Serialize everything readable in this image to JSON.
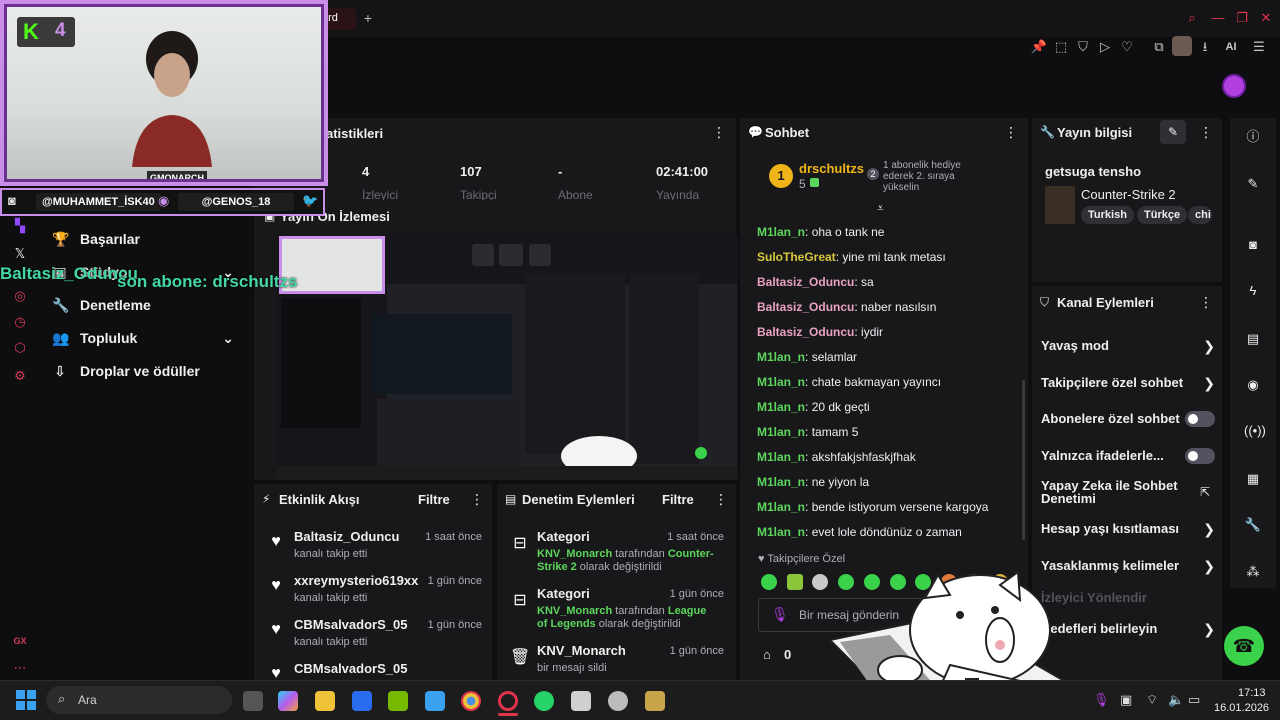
{
  "browser": {
    "active_tab_suffix": "ard",
    "add_tab": "+",
    "ai_label": "AI"
  },
  "webcam": {
    "logo_letter": "K",
    "logo_number": "4",
    "streamer_tag": "GMONARCH"
  },
  "socials": {
    "instagram": "@MUHAMMET_İSK40",
    "twitch": "@GENOS_18"
  },
  "sub_alert": "son abone: drschultzs",
  "sub_alert_name_overlay": "Baltasiz_Oduncu",
  "sidebar": {
    "items": [
      {
        "label": "Başarılar"
      },
      {
        "label": "Stüdyo"
      },
      {
        "label": "Denetleme"
      },
      {
        "label": "Topluluk"
      },
      {
        "label": "Droplar ve ödüller"
      }
    ],
    "footer": "GX"
  },
  "stats": {
    "title_partial": "atistikleri",
    "values": [
      {
        "value": "4",
        "label": "İzleyici"
      },
      {
        "value": "107",
        "label": "Takipçi"
      },
      {
        "value": "-",
        "label": "Abone"
      },
      {
        "value": "02:41:00",
        "label": "Yayında"
      }
    ]
  },
  "preview": {
    "title": "Yayın Ön İzlemesi"
  },
  "activity": {
    "title": "Etkinlik Akışı",
    "filter": "Filtre",
    "items": [
      {
        "name": "Baltasiz_Oduncu",
        "action": "kanalı takip etti",
        "time": "1 saat önce"
      },
      {
        "name": "xxreymysterio619xx",
        "action": "kanalı takip etti",
        "time": "1 gün önce"
      },
      {
        "name": "CBMsalvadorS_05",
        "action": "kanalı takip etti",
        "time": "1 gün önce"
      },
      {
        "name": "CBMsalvadorS_05",
        "action": "",
        "time": ""
      }
    ]
  },
  "moderation": {
    "title": "Denetim Eylemleri",
    "filter": "Filtre",
    "items": [
      {
        "name": "Kategori",
        "time": "1 saat önce",
        "user": "KNV_Monarch",
        "mid": " tarafından ",
        "target": "Counter-Strike 2",
        "end": " olarak değiştirildi"
      },
      {
        "name": "Kategori",
        "time": "1 gün önce",
        "user": "KNV_Monarch",
        "mid": " tarafından ",
        "target": "League of Legends",
        "end": " olarak değiştirildi"
      },
      {
        "name": "KNV_Monarch",
        "time": "1 gün önce",
        "user": "",
        "mid": "bir mesajı sildi",
        "target": "",
        "end": ""
      }
    ]
  },
  "chat": {
    "title": "Sohbet",
    "top_user": "drschultzs",
    "top_rank": "1",
    "top_count": "5",
    "gift_rank": "2",
    "gift_text": "1 abonelik hediye ederek 2. sıraya yükselin",
    "messages": [
      {
        "user": "M1lan_n",
        "color": "#5cd65c",
        "text": "oha o tank ne"
      },
      {
        "user": "SuloTheGreat",
        "color": "#d7c83a",
        "text": "yine mi tank metası"
      },
      {
        "user": "Baltasiz_Oduncu",
        "color": "#e8a2c0",
        "text": "sa"
      },
      {
        "user": "Baltasiz_Oduncu",
        "color": "#e8a2c0",
        "text": "naber nasılsın"
      },
      {
        "user": "Baltasiz_Oduncu",
        "color": "#e8a2c0",
        "text": "iydir"
      },
      {
        "user": "M1lan_n",
        "color": "#5cd65c",
        "text": "selamlar"
      },
      {
        "user": "M1lan_n",
        "color": "#5cd65c",
        "text": "chate bakmayan yayıncı"
      },
      {
        "user": "M1lan_n",
        "color": "#5cd65c",
        "text": "20 dk geçti"
      },
      {
        "user": "M1lan_n",
        "color": "#5cd65c",
        "text": "tamam 5"
      },
      {
        "user": "M1lan_n",
        "color": "#5cd65c",
        "text": "akshfakjshfaskjfhak"
      },
      {
        "user": "M1lan_n",
        "color": "#5cd65c",
        "text": "ne yiyon la"
      },
      {
        "user": "M1lan_n",
        "color": "#5cd65c",
        "text": "bende istiyorum versene kargoya"
      },
      {
        "user": "M1lan_n",
        "color": "#5cd65c",
        "text": "evet lole döndünüz o zaman"
      }
    ],
    "followers_only": "Takipçilere Özel",
    "input_placeholder": "Bir mesaj gönderin",
    "points": "0"
  },
  "stream_info": {
    "title": "Yayın bilgisi",
    "stream_title": "getsuga tensho",
    "category": "Counter-Strike 2",
    "tags": [
      "Turkish",
      "Türkçe",
      "chi"
    ]
  },
  "channel_actions": {
    "title": "Kanal Eylemleri",
    "items": [
      {
        "label": "Yavaş mod",
        "kind": "chevron"
      },
      {
        "label": "Takipçilere özel sohbet",
        "kind": "chevron"
      },
      {
        "label": "Abonelere özel sohbet",
        "kind": "toggle"
      },
      {
        "label": "Yalnızca ifadelerle...",
        "kind": "toggle"
      },
      {
        "label": "Yapay Zeka ile Sohbet Denetimi",
        "kind": "external"
      },
      {
        "label": "Hesap yaşı kısıtlaması",
        "kind": "chevron"
      },
      {
        "label": "Yasaklanmış kelimeler",
        "kind": "chevron"
      },
      {
        "label": "İzleyici Yönlendir",
        "kind": "disabled"
      },
      {
        "label": "Hedefleri belirleyin",
        "kind": "chevron"
      }
    ]
  },
  "taskbar": {
    "search_label": "Ara",
    "time": "17:13",
    "date": "16.01.2026"
  },
  "colors": {
    "accent_green": "#5cd65c",
    "brand_red": "#d43b59",
    "panel_bg": "#18181b",
    "page_bg": "#0e0e10",
    "webcam_frame": "#c98fe8"
  }
}
